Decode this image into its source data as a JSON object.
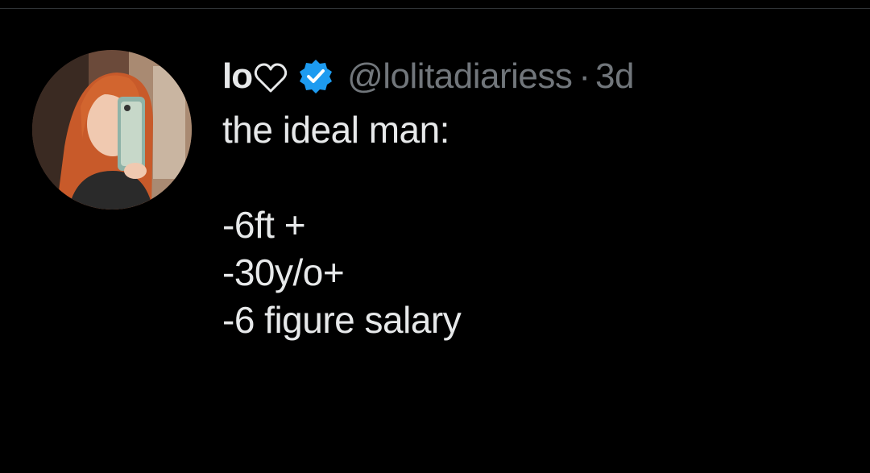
{
  "tweet": {
    "display_name": "lo",
    "name_emoji": "heart-outline-icon",
    "verified": true,
    "verified_color": "#1d9bf0",
    "handle": "@lolitadiariess",
    "separator": "·",
    "timestamp": "3d",
    "text_lines": [
      "the ideal man:",
      "",
      "-6ft +",
      "-30y/o+",
      "-6 figure salary"
    ]
  },
  "colors": {
    "background": "#000000",
    "primary_text": "#e7e9ea",
    "secondary_text": "#71767b",
    "accent": "#1d9bf0"
  }
}
